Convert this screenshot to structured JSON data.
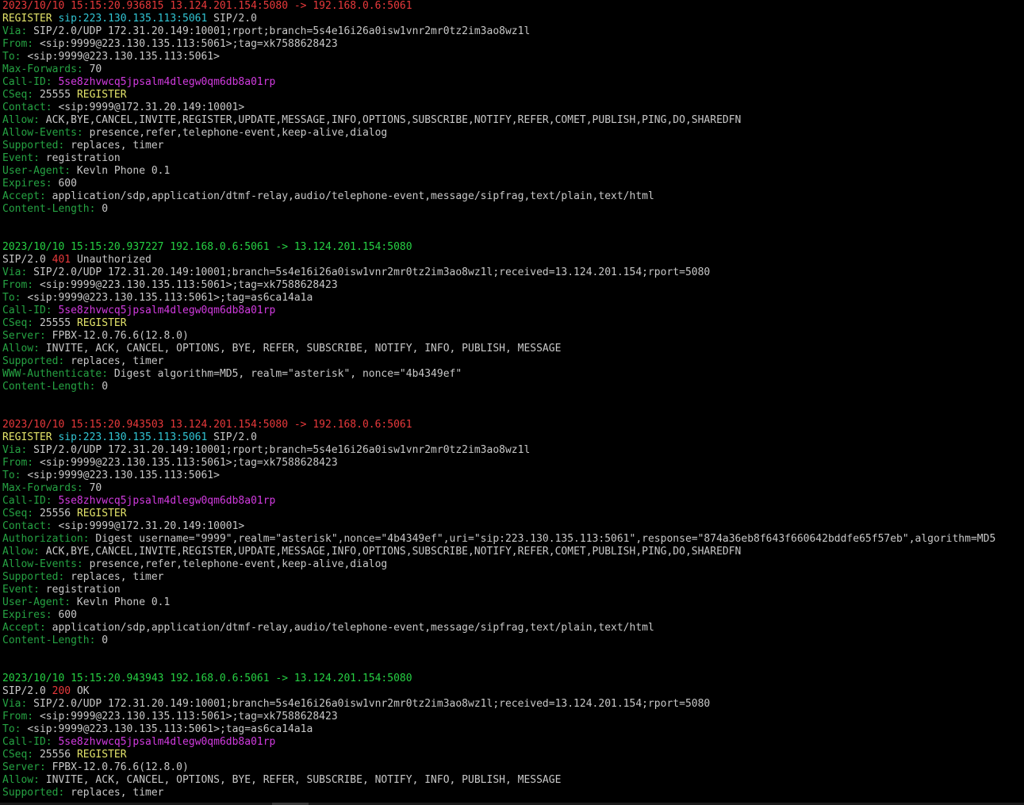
{
  "colors": {
    "background": "#000000",
    "header": "#26a343",
    "value": "#c8c8c8",
    "call_id": "#d23be0",
    "method": "#e3e36a",
    "uri": "#31c5d4",
    "status_code": "#e8393b",
    "timestamp_outbound": "#e8393b",
    "timestamp_inbound": "#26d043"
  },
  "messages": [
    {
      "timestamp_line": "2023/10/10 15:15:20.936815 13.124.201.154:5080 -> 192.168.0.6:5061",
      "direction": "outbound",
      "start_line": {
        "kind": "request",
        "method": "REGISTER",
        "uri": "sip:223.130.135.113:5061",
        "version": "SIP/2.0"
      },
      "headers": [
        {
          "name": "Via:",
          "value": "SIP/2.0/UDP 172.31.20.149:10001;rport;branch=5s4e16i26a0isw1vnr2mr0tz2im3ao8wz1l",
          "style": "val"
        },
        {
          "name": "From:",
          "value": "<sip:9999@223.130.135.113:5061>;tag=xk7588628423",
          "style": "val"
        },
        {
          "name": "To:",
          "value": "<sip:9999@223.130.135.113:5061>",
          "style": "val"
        },
        {
          "name": "Max-Forwards:",
          "value": "70",
          "style": "val"
        },
        {
          "name": "Call-ID:",
          "value": "5se8zhvwcq5jpsalm4dlegw0qm6db8a01rp",
          "style": "callid"
        },
        {
          "name": "CSeq:",
          "value": "25555",
          "method": "REGISTER",
          "style": "cseq"
        },
        {
          "name": "Contact:",
          "value": "<sip:9999@172.31.20.149:10001>",
          "style": "val"
        },
        {
          "name": "Allow:",
          "value": "ACK,BYE,CANCEL,INVITE,REGISTER,UPDATE,MESSAGE,INFO,OPTIONS,SUBSCRIBE,NOTIFY,REFER,COMET,PUBLISH,PING,DO,SHAREDFN",
          "style": "val"
        },
        {
          "name": "Allow-Events:",
          "value": "presence,refer,telephone-event,keep-alive,dialog",
          "style": "val"
        },
        {
          "name": "Supported:",
          "value": "replaces, timer",
          "style": "val"
        },
        {
          "name": "Event:",
          "value": "registration",
          "style": "val"
        },
        {
          "name": "User-Agent:",
          "value": "Kevln Phone 0.1",
          "style": "val"
        },
        {
          "name": "Expires:",
          "value": "600",
          "style": "val"
        },
        {
          "name": "Accept:",
          "value": "application/sdp,application/dtmf-relay,audio/telephone-event,message/sipfrag,text/plain,text/html",
          "style": "val"
        },
        {
          "name": "Content-Length:",
          "value": "0",
          "style": "val"
        }
      ]
    },
    {
      "timestamp_line": "2023/10/10 15:15:20.937227 192.168.0.6:5061 -> 13.124.201.154:5080",
      "direction": "inbound",
      "start_line": {
        "kind": "response",
        "version": "SIP/2.0",
        "code": "401",
        "reason": "Unauthorized"
      },
      "headers": [
        {
          "name": "Via:",
          "value": "SIP/2.0/UDP 172.31.20.149:10001;branch=5s4e16i26a0isw1vnr2mr0tz2im3ao8wz1l;received=13.124.201.154;rport=5080",
          "style": "val"
        },
        {
          "name": "From:",
          "value": "<sip:9999@223.130.135.113:5061>;tag=xk7588628423",
          "style": "val"
        },
        {
          "name": "To:",
          "value": "<sip:9999@223.130.135.113:5061>;tag=as6ca14a1a",
          "style": "val"
        },
        {
          "name": "Call-ID:",
          "value": "5se8zhvwcq5jpsalm4dlegw0qm6db8a01rp",
          "style": "callid"
        },
        {
          "name": "CSeq:",
          "value": "25555",
          "method": "REGISTER",
          "style": "cseq"
        },
        {
          "name": "Server:",
          "value": "FPBX-12.0.76.6(12.8.0)",
          "style": "val"
        },
        {
          "name": "Allow:",
          "value": "INVITE, ACK, CANCEL, OPTIONS, BYE, REFER, SUBSCRIBE, NOTIFY, INFO, PUBLISH, MESSAGE",
          "style": "val"
        },
        {
          "name": "Supported:",
          "value": "replaces, timer",
          "style": "val"
        },
        {
          "name": "WWW-Authenticate:",
          "value": "Digest algorithm=MD5, realm=\"asterisk\", nonce=\"4b4349ef\"",
          "style": "val"
        },
        {
          "name": "Content-Length:",
          "value": "0",
          "style": "val"
        }
      ]
    },
    {
      "timestamp_line": "2023/10/10 15:15:20.943503 13.124.201.154:5080 -> 192.168.0.6:5061",
      "direction": "outbound",
      "start_line": {
        "kind": "request",
        "method": "REGISTER",
        "uri": "sip:223.130.135.113:5061",
        "version": "SIP/2.0"
      },
      "headers": [
        {
          "name": "Via:",
          "value": "SIP/2.0/UDP 172.31.20.149:10001;rport;branch=5s4e16i26a0isw1vnr2mr0tz2im3ao8wz1l",
          "style": "val"
        },
        {
          "name": "From:",
          "value": "<sip:9999@223.130.135.113:5061>;tag=xk7588628423",
          "style": "val"
        },
        {
          "name": "To:",
          "value": "<sip:9999@223.130.135.113:5061>",
          "style": "val"
        },
        {
          "name": "Max-Forwards:",
          "value": "70",
          "style": "val"
        },
        {
          "name": "Call-ID:",
          "value": "5se8zhvwcq5jpsalm4dlegw0qm6db8a01rp",
          "style": "callid"
        },
        {
          "name": "CSeq:",
          "value": "25556",
          "method": "REGISTER",
          "style": "cseq"
        },
        {
          "name": "Contact:",
          "value": "<sip:9999@172.31.20.149:10001>",
          "style": "val"
        },
        {
          "name": "Authorization:",
          "value": "Digest username=\"9999\",realm=\"asterisk\",nonce=\"4b4349ef\",uri=\"sip:223.130.135.113:5061\",response=\"874a36eb8f643f660642bddfe65f57eb\",algorithm=MD5",
          "style": "val"
        },
        {
          "name": "Allow:",
          "value": "ACK,BYE,CANCEL,INVITE,REGISTER,UPDATE,MESSAGE,INFO,OPTIONS,SUBSCRIBE,NOTIFY,REFER,COMET,PUBLISH,PING,DO,SHAREDFN",
          "style": "val"
        },
        {
          "name": "Allow-Events:",
          "value": "presence,refer,telephone-event,keep-alive,dialog",
          "style": "val"
        },
        {
          "name": "Supported:",
          "value": "replaces, timer",
          "style": "val"
        },
        {
          "name": "Event:",
          "value": "registration",
          "style": "val"
        },
        {
          "name": "User-Agent:",
          "value": "Kevln Phone 0.1",
          "style": "val"
        },
        {
          "name": "Expires:",
          "value": "600",
          "style": "val"
        },
        {
          "name": "Accept:",
          "value": "application/sdp,application/dtmf-relay,audio/telephone-event,message/sipfrag,text/plain,text/html",
          "style": "val"
        },
        {
          "name": "Content-Length:",
          "value": "0",
          "style": "val"
        }
      ]
    },
    {
      "timestamp_line": "2023/10/10 15:15:20.943943 192.168.0.6:5061 -> 13.124.201.154:5080",
      "direction": "inbound",
      "start_line": {
        "kind": "response",
        "version": "SIP/2.0",
        "code": "200",
        "reason": "OK"
      },
      "headers": [
        {
          "name": "Via:",
          "value": "SIP/2.0/UDP 172.31.20.149:10001;branch=5s4e16i26a0isw1vnr2mr0tz2im3ao8wz1l;received=13.124.201.154;rport=5080",
          "style": "val"
        },
        {
          "name": "From:",
          "value": "<sip:9999@223.130.135.113:5061>;tag=xk7588628423",
          "style": "val"
        },
        {
          "name": "To:",
          "value": "<sip:9999@223.130.135.113:5061>;tag=as6ca14a1a",
          "style": "val"
        },
        {
          "name": "Call-ID:",
          "value": "5se8zhvwcq5jpsalm4dlegw0qm6db8a01rp",
          "style": "callid"
        },
        {
          "name": "CSeq:",
          "value": "25556",
          "method": "REGISTER",
          "style": "cseq"
        },
        {
          "name": "Server:",
          "value": "FPBX-12.0.76.6(12.8.0)",
          "style": "val"
        },
        {
          "name": "Allow:",
          "value": "INVITE, ACK, CANCEL, OPTIONS, BYE, REFER, SUBSCRIBE, NOTIFY, INFO, PUBLISH, MESSAGE",
          "style": "val"
        },
        {
          "name": "Supported:",
          "value": "replaces, timer",
          "style": "val"
        }
      ]
    }
  ]
}
